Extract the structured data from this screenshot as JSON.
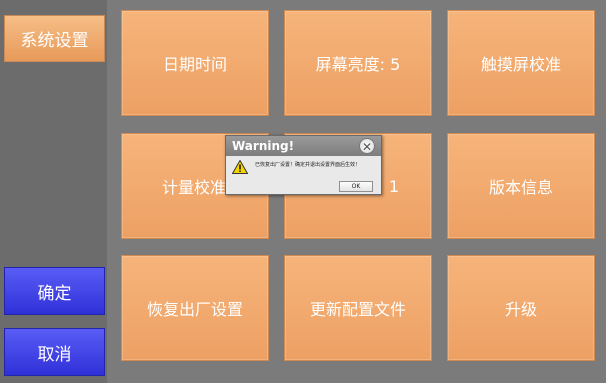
{
  "sidebar": {
    "tab_label": "系统设置",
    "confirm_label": "确定",
    "cancel_label": "取消"
  },
  "tiles": {
    "date_time": "日期时间",
    "screen_brightness": "屏幕亮度: 5",
    "touch_calibration": "触摸屏校准",
    "metering_calibration": "计量校准",
    "hidden_setting_value": ": 1",
    "version_info": "版本信息",
    "factory_reset": "恢复出厂设置",
    "update_config": "更新配置文件",
    "upgrade": "升级"
  },
  "dialog": {
    "title": "Warning!",
    "message": "已恢复出厂设置！确定并退出设置界面后生效！",
    "ok_label": "OK",
    "icon": "warning-icon",
    "close_icon": "close-icon"
  },
  "colors": {
    "tile": "#eda064",
    "side_button": "#3a3ce6",
    "background": "#7b7b7b"
  }
}
